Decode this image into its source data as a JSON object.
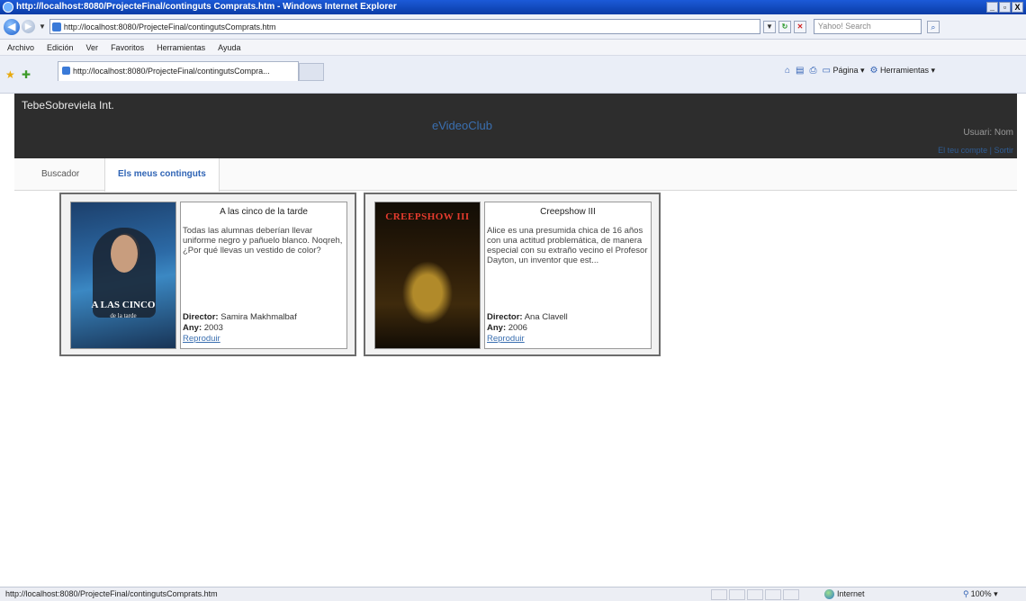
{
  "window": {
    "title": "http://localhost:8080/ProjecteFinal/continguts Comprats.htm - Windows Internet Explorer",
    "minimize": "_",
    "maximize": "▫",
    "close": "X"
  },
  "address_bar": {
    "url": "http://localhost:8080/ProjecteFinal/contingutsComprats.htm",
    "search_placeholder": "Yahoo! Search"
  },
  "menu": [
    "Archivo",
    "Edición",
    "Ver",
    "Favoritos",
    "Herramientas",
    "Ayuda"
  ],
  "tab": {
    "label": "http://localhost:8080/ProjecteFinal/contingutsCompra..."
  },
  "command_bar": {
    "page_label": "Página",
    "tools_label": "Herramientas"
  },
  "site": {
    "brand": "TebeSobreviela Int.",
    "title": "eVideoClub",
    "user_label": "Usuari: Nom",
    "link_account": "El teu compte",
    "link_separator": " | ",
    "link_logout": "Sortir"
  },
  "nav": {
    "search": "Buscador",
    "my_content": "Els meus continguts"
  },
  "movies": [
    {
      "title": "A las cinco de la tarde",
      "synopsis": "Todas las alumnas deberían llevar uniforme negro y pañuelo blanco. Noqreh, ¿Por qué llevas un vestido de color?",
      "director_label": "Director:",
      "director": "Samira Makhmalbaf",
      "year_label": "Any:",
      "year": "2003",
      "play": "Reproduir",
      "poster_title": "A LAS CINCO",
      "poster_subtitle": "de la tarde"
    },
    {
      "title": "Creepshow III",
      "synopsis": "Alice es una presumida chica de 16 años con una actitud problemática, de manera especial con su extraño vecino el Profesor Dayton, un inventor que est...",
      "director_label": "Director:",
      "director": "Ana Clavell",
      "year_label": "Any:",
      "year": "2006",
      "play": "Reproduir",
      "poster_title": "CREEPSHOW III"
    }
  ],
  "status_bar": {
    "url": "http://localhost:8080/ProjecteFinal/contingutsComprats.htm",
    "zone": "Internet",
    "zoom": "100%"
  }
}
